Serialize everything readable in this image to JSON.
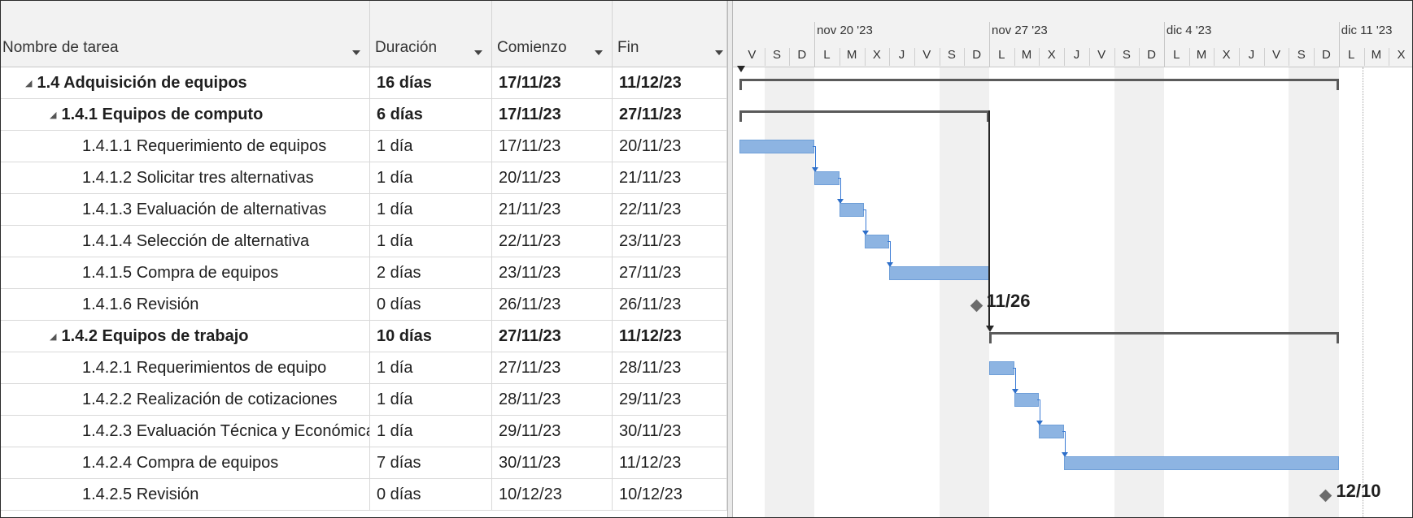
{
  "columns": {
    "name": "Nombre de tarea",
    "duration": "Duración",
    "start": "Comienzo",
    "finish": "Fin"
  },
  "timescale": {
    "weeks": [
      "nov 20 '23",
      "nov 27 '23",
      "dic 4 '23",
      "dic 11 '23"
    ],
    "days": [
      "V",
      "S",
      "D",
      "L",
      "M",
      "X",
      "J",
      "V",
      "S",
      "D",
      "L",
      "M",
      "X",
      "J",
      "V",
      "S",
      "D",
      "L",
      "M",
      "X",
      "J",
      "V",
      "S",
      "D",
      "L",
      "M",
      "X"
    ]
  },
  "tasks": [
    {
      "name": "1.4  Adquisición de equipos",
      "duration": "16 días",
      "start": "17/11/23",
      "finish": "11/12/23",
      "summary": true
    },
    {
      "name": "1.4.1  Equipos de computo",
      "duration": "6 días",
      "start": "17/11/23",
      "finish": "27/11/23",
      "summary": true
    },
    {
      "name": "1.4.1.1  Requerimiento de equipos",
      "duration": "1 día",
      "start": "17/11/23",
      "finish": "20/11/23"
    },
    {
      "name": "1.4.1.2  Solicitar tres alternativas",
      "duration": "1 día",
      "start": "20/11/23",
      "finish": "21/11/23"
    },
    {
      "name": "1.4.1.3  Evaluación de alternativas",
      "duration": "1 día",
      "start": "21/11/23",
      "finish": "22/11/23"
    },
    {
      "name": "1.4.1.4  Selección de alternativa",
      "duration": "1 día",
      "start": "22/11/23",
      "finish": "23/11/23"
    },
    {
      "name": "1.4.1.5  Compra de equipos",
      "duration": "2 días",
      "start": "23/11/23",
      "finish": "27/11/23"
    },
    {
      "name": "1.4.1.6  Revisión",
      "duration": "0 días",
      "start": "26/11/23",
      "finish": "26/11/23",
      "milestone": "11/26"
    },
    {
      "name": "1.4.2  Equipos de trabajo",
      "duration": "10 días",
      "start": "27/11/23",
      "finish": "11/12/23",
      "summary": true
    },
    {
      "name": "1.4.2.1  Requerimientos de equipo",
      "duration": "1 día",
      "start": "27/11/23",
      "finish": "28/11/23"
    },
    {
      "name": "1.4.2.2  Realización de cotizaciones",
      "duration": "1 día",
      "start": "28/11/23",
      "finish": "29/11/23"
    },
    {
      "name": "1.4.2.3  Evaluación Técnica y Económica",
      "duration": "1 día",
      "start": "29/11/23",
      "finish": "30/11/23"
    },
    {
      "name": "1.4.2.4  Compra de equipos",
      "duration": "7 días",
      "start": "30/11/23",
      "finish": "11/12/23"
    },
    {
      "name": "1.4.2.5  Revisión",
      "duration": "0 días",
      "start": "10/12/23",
      "finish": "10/12/23",
      "milestone": "12/10"
    }
  ],
  "colors": {
    "bar": "#8db4e2",
    "summary": "#5a5a5a",
    "link": "#3a7bd5",
    "milestone": "#6b6b6b",
    "weekend": "#f0f0f0"
  }
}
